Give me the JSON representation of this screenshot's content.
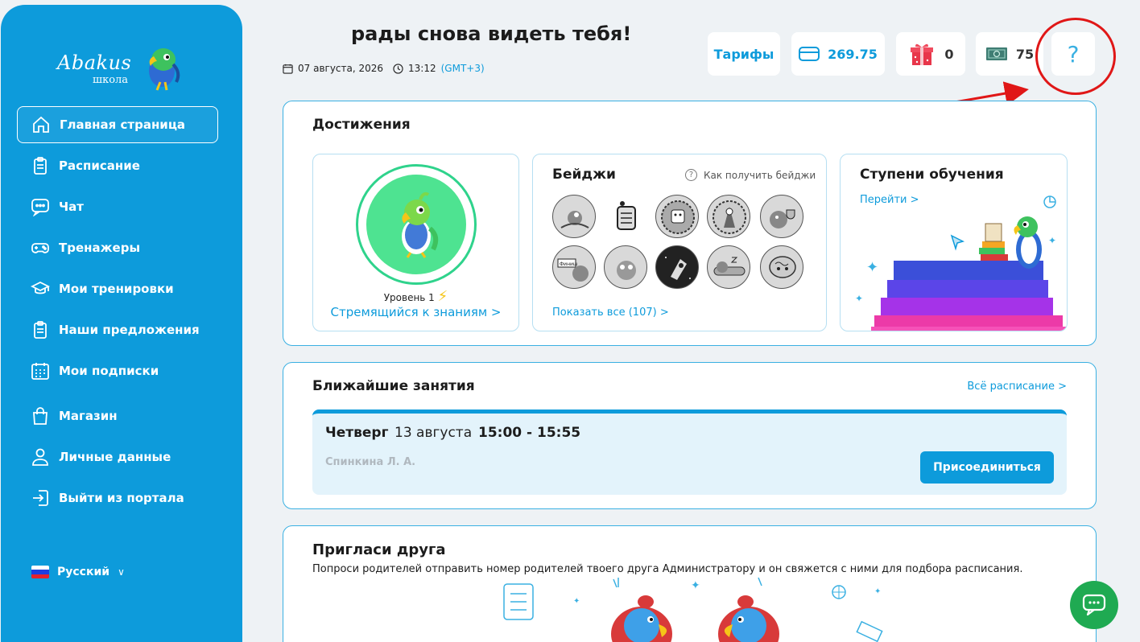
{
  "sidebar": {
    "logo": {
      "title": "Abakus",
      "subtitle": "школа"
    },
    "items": [
      {
        "label": "Главная страница",
        "icon": "home-icon",
        "active": true
      },
      {
        "label": "Расписание",
        "icon": "clipboard-icon"
      },
      {
        "label": "Чат",
        "icon": "chat-icon"
      },
      {
        "label": "Тренажеры",
        "icon": "gamepad-icon"
      },
      {
        "label": "Мои тренировки",
        "icon": "graduation-cap-icon"
      },
      {
        "label": "Наши предложения",
        "icon": "clipboard-icon"
      },
      {
        "label": "Мои подписки",
        "icon": "calendar-icon"
      },
      {
        "label": "Магазин",
        "icon": "shopping-bag-icon"
      },
      {
        "label": "Личные данные",
        "icon": "user-icon"
      },
      {
        "label": "Выйти из портала",
        "icon": "logout-icon"
      }
    ],
    "language": "Русский"
  },
  "header": {
    "greeting": "рады снова видеть тебя!",
    "date": "07 августа, 2026",
    "time": "13:12",
    "timezone": "(GMT+3)",
    "tariffs_label": "Тарифы",
    "balance": "269.75",
    "gifts_count": "0",
    "money_count": "75",
    "help_label": "?"
  },
  "achievements": {
    "title": "Достижения",
    "level_text": "Уровень 1",
    "level_link": "Стремящийся к знаниям >",
    "badges_title": "Бейджи",
    "badges_help": "Как получить бейджи",
    "badges_show_all": "Показать все (107) >",
    "steps_title": "Ступени обучения",
    "steps_link": "Перейти >",
    "badge_sign": "Финиш"
  },
  "lessons": {
    "title": "Ближайшие занятия",
    "all_link": "Всё расписание >",
    "items": [
      {
        "day": "Четверг",
        "date": "13 августа",
        "time": "15:00 - 15:55",
        "teacher": "Спинкина Л. А.",
        "join_label": "Присоединиться"
      }
    ]
  },
  "invite": {
    "title": "Пригласи друга",
    "text": "Попроси родителей отправить номер родителей твоего друга Администратору и он свяжется с ними для подбора расписания."
  },
  "colors": {
    "brand": "#0d9bdb",
    "annotation": "#e01717",
    "chat": "#1faa52",
    "progress_green": "#2fd38c"
  }
}
